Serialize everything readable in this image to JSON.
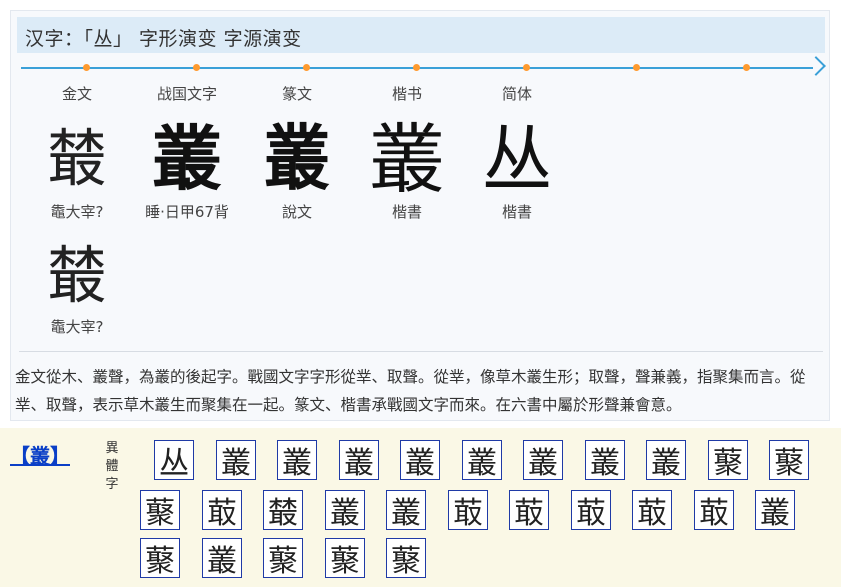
{
  "header": {
    "title": "汉字：「丛」 字形演变 字源演变"
  },
  "timeline": {
    "colors": {
      "line": "#3aa0d8",
      "dot": "#ff9a2e"
    },
    "columns": [
      {
        "era": "金文",
        "glyph": "樷",
        "source": "鼄大宰?"
      },
      {
        "era": "战国文字",
        "glyph": "叢",
        "source": "睡·日甲67背"
      },
      {
        "era": "篆文",
        "glyph": "叢",
        "source": "說文"
      },
      {
        "era": "楷书",
        "glyph": "叢",
        "source": "楷書"
      },
      {
        "era": "简体",
        "glyph": "丛",
        "source": "楷書"
      }
    ],
    "extra": {
      "glyph": "樷",
      "source": "鼄大宰?"
    }
  },
  "description": "金文從木、叢聲，為叢的後起字。戰國文字字形從丵、取聲。從丵，像草木叢生形；取聲，聲兼義，指聚集而言。從丵、取聲，表示草木叢生而聚集在一起。篆文、楷書承戰國文字而來。在六書中屬於形聲兼會意。",
  "variants": {
    "head": "【叢】",
    "label": "異體字",
    "chars": [
      "丛",
      "叢",
      "叢",
      "叢",
      "叢",
      "叢",
      "叢",
      "叢",
      "叢",
      "藂",
      "藂",
      "藂",
      "菆",
      "樷",
      "叢",
      "叢",
      "菆",
      "菆",
      "菆",
      "菆",
      "菆",
      "叢",
      "藂",
      "叢",
      "藂",
      "藂",
      "藂"
    ]
  }
}
